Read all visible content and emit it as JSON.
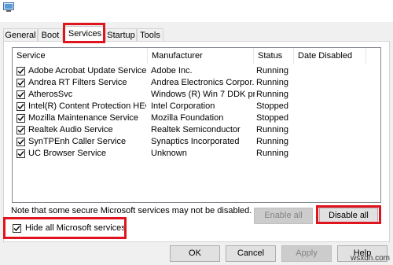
{
  "tabs": [
    {
      "label": "General"
    },
    {
      "label": "Boot"
    },
    {
      "label": "Services",
      "active": true
    },
    {
      "label": "Startup"
    },
    {
      "label": "Tools"
    }
  ],
  "columns": [
    "Service",
    "Manufacturer",
    "Status",
    "Date Disabled"
  ],
  "services": [
    {
      "checked": true,
      "service": "Adobe Acrobat Update Service",
      "manufacturer": "Adobe Inc.",
      "status": "Running",
      "date_disabled": ""
    },
    {
      "checked": true,
      "service": "Andrea RT Filters Service",
      "manufacturer": "Andrea Electronics Corpor...",
      "status": "Running",
      "date_disabled": ""
    },
    {
      "checked": true,
      "service": "AtherosSvc",
      "manufacturer": "Windows (R) Win 7 DDK pr...",
      "status": "Running",
      "date_disabled": ""
    },
    {
      "checked": true,
      "service": "Intel(R) Content Protection HEC...",
      "manufacturer": "Intel Corporation",
      "status": "Stopped",
      "date_disabled": ""
    },
    {
      "checked": true,
      "service": "Mozilla Maintenance Service",
      "manufacturer": "Mozilla Foundation",
      "status": "Stopped",
      "date_disabled": ""
    },
    {
      "checked": true,
      "service": "Realtek Audio Service",
      "manufacturer": "Realtek Semiconductor",
      "status": "Running",
      "date_disabled": ""
    },
    {
      "checked": true,
      "service": "SynTPEnh Caller Service",
      "manufacturer": "Synaptics Incorporated",
      "status": "Running",
      "date_disabled": ""
    },
    {
      "checked": true,
      "service": "UC Browser Service",
      "manufacturer": "Unknown",
      "status": "Running",
      "date_disabled": ""
    }
  ],
  "note": "Note that some secure Microsoft services may not be disabled.",
  "enable_all": "Enable all",
  "disable_all": "Disable all",
  "hide_ms": {
    "label": "Hide all Microsoft services",
    "checked": true
  },
  "footer": {
    "ok": "OK",
    "cancel": "Cancel",
    "apply": "Apply",
    "help": "Help"
  },
  "watermark": "wsxdn.com",
  "colors": {
    "highlight": "#e0141e"
  }
}
